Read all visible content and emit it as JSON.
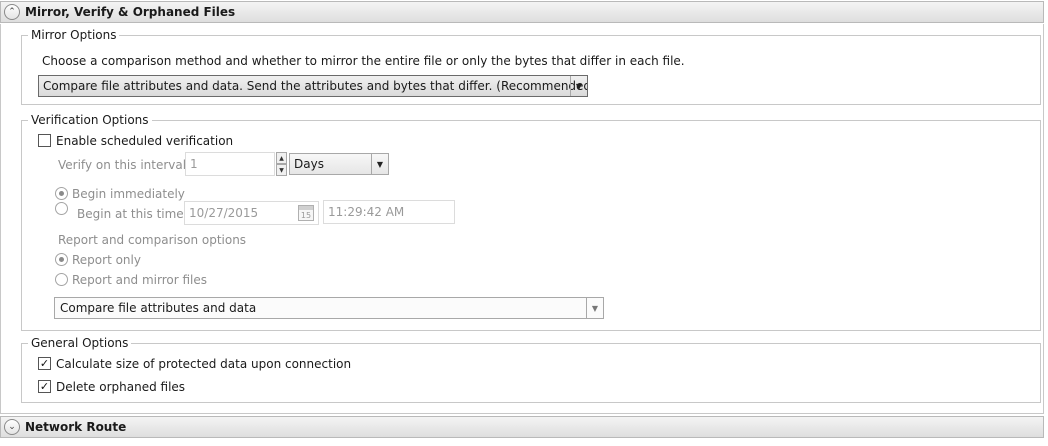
{
  "mirror_section": {
    "title": "Mirror, Verify & Orphaned Files",
    "expander_icon": "chevron-up-icon",
    "mirror_options": {
      "legend": "Mirror Options",
      "description": "Choose a comparison method and whether to mirror the entire file or only the bytes that differ in each file.",
      "method_selected": "Compare file attributes and data. Send the attributes and bytes that differ. (Recommended for data"
    },
    "verification_options": {
      "legend": "Verification Options",
      "enable_label": "Enable scheduled verification",
      "enable_checked": false,
      "interval_label": "Verify on this interval:",
      "interval_value": "1",
      "interval_unit": "Days",
      "begin_immediately_label": "Begin immediately",
      "begin_at_label": "Begin at this time:",
      "begin_date": "10/27/2015",
      "calendar_day": "15",
      "begin_time": "11:29:42 AM",
      "report_heading": "Report and comparison options",
      "report_only_label": "Report only",
      "report_mirror_label": "Report and mirror files",
      "compare_selected": "Compare file attributes and data"
    },
    "general_options": {
      "legend": "General Options",
      "calculate_label": "Calculate size of protected data upon connection",
      "calculate_checked": true,
      "delete_orphaned_label": "Delete orphaned files",
      "delete_orphaned_checked": true
    }
  },
  "network_section": {
    "title": "Network Route",
    "expander_icon": "chevron-down-icon"
  }
}
